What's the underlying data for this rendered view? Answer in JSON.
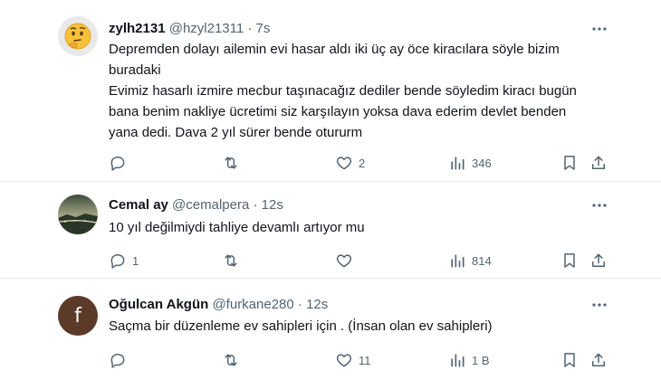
{
  "tweets": [
    {
      "name": "zylh2131",
      "handle": "@hzyl21311",
      "time": "· 7s",
      "text": [
        "Depremden dolayı ailemin evi hasar aldı iki üç ay öce kiracılara söyle bizim buradaki",
        "Evimiz hasarlı izmire mecbur taşınacağız dediler bende söyledim kiracı bugün bana benim nakliye ücretimi siz karşılayın yoksa dava ederim devlet benden yana dedi. Dava 2 yıl sürer bende otururm"
      ],
      "replies": "",
      "retweets": "",
      "likes": "2",
      "views": "346",
      "avatar_icon": "thinking-face-emoji"
    },
    {
      "name": "Cemal ay",
      "handle": "@cemalpera",
      "time": "· 12s",
      "text": [
        "10 yıl değilmiydi tahliye devamlı artıyor mu"
      ],
      "replies": "1",
      "retweets": "",
      "likes": "",
      "views": "814",
      "avatar_icon": "landscape-photo"
    },
    {
      "name": "Oğulcan Akgün",
      "handle": "@furkane280",
      "time": "· 12s",
      "text": [
        "Saçma bir düzenleme ev sahipleri için . (İnsan olan ev sahipleri)"
      ],
      "replies": "",
      "retweets": "",
      "likes": "11",
      "views": "1 B",
      "avatar_letter": "f",
      "avatar_color": "#5b3a29"
    }
  ],
  "colors": {
    "text": "#0f1419",
    "secondary": "#536471",
    "divider": "#e6ecf0"
  }
}
